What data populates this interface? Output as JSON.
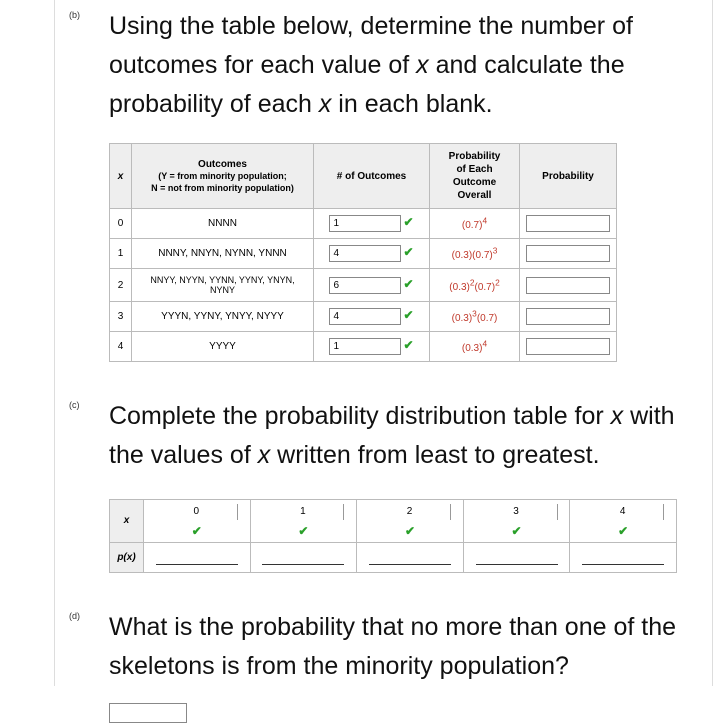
{
  "parts": {
    "b": {
      "label": "(b)",
      "prompt_pre": "Using the table below, determine the number of outcomes for each value of ",
      "prompt_var1": "x",
      "prompt_mid": " and calculate the probability of each ",
      "prompt_var2": "x",
      "prompt_post": " in each blank."
    },
    "c": {
      "label": "(c)",
      "prompt_pre": "Complete the probability distribution table for ",
      "prompt_var1": "x",
      "prompt_mid": " with the values of ",
      "prompt_var2": "x",
      "prompt_post": " written from least to greatest."
    },
    "d": {
      "label": "(d)",
      "prompt": "What is the probability that no more than one of the skeletons is from the minority population?"
    }
  },
  "table1": {
    "headers": {
      "x": "x",
      "outcomes_title": "Outcomes",
      "outcomes_sub1": "(Y = from minority population;",
      "outcomes_sub2": "N = not from minority population)",
      "num": "# of Outcomes",
      "prob_each_l1": "Probability",
      "prob_each_l2": "of Each Outcome",
      "prob_each_l3": "Overall",
      "prob": "Probability"
    },
    "rows": [
      {
        "x": "0",
        "outcomes": "NNNN",
        "num": "1",
        "prob_base": "(0.7)",
        "prob_exp": "4",
        "prob_pre": ""
      },
      {
        "x": "1",
        "outcomes": "NNNY, NNYN, NYNN, YNNN",
        "num": "4",
        "prob_pre": "(0.3)(0.7)",
        "prob_exp": "3",
        "prob_base": ""
      },
      {
        "x": "2",
        "outcomes": "NNYY, NYYN, YYNN, YYNY, YNYN, NYNY",
        "num": "6",
        "prob_pre": "(0.3)",
        "prob_mid_exp": "2",
        "prob_post": "(0.7)",
        "prob_exp": "2"
      },
      {
        "x": "3",
        "outcomes": "YYYN, YYNY, YNYY, NYYY",
        "num": "4",
        "prob_pre": "(0.3)",
        "prob_mid_exp": "3",
        "prob_post": "(0.7)",
        "prob_exp": ""
      },
      {
        "x": "4",
        "outcomes": "YYYY",
        "num": "1",
        "prob_base": "(0.3)",
        "prob_exp": "4",
        "prob_pre": ""
      }
    ]
  },
  "table2": {
    "row1_label": "x",
    "row2_label": "p(x)",
    "xvals": [
      "0",
      "1",
      "2",
      "3",
      "4"
    ]
  },
  "chart_data": {
    "type": "table",
    "title": "Binomial outcomes n=4, p=0.3 (Y=minority, N=not minority)",
    "columns": [
      "x",
      "Outcomes",
      "# of Outcomes",
      "Probability of Each Outcome",
      "Probability"
    ],
    "rows": [
      {
        "x": 0,
        "outcomes": "NNNN",
        "n_outcomes": 1,
        "each_outcome_prob": "(0.7)^4",
        "probability": null
      },
      {
        "x": 1,
        "outcomes": "NNNY, NNYN, NYNN, YNNN",
        "n_outcomes": 4,
        "each_outcome_prob": "(0.3)(0.7)^3",
        "probability": null
      },
      {
        "x": 2,
        "outcomes": "NNYY, NYYN, YYNN, YYNY, YNYN, NYNY",
        "n_outcomes": 6,
        "each_outcome_prob": "(0.3)^2(0.7)^2",
        "probability": null
      },
      {
        "x": 3,
        "outcomes": "YYYN, YYNY, YNYY, NYYY",
        "n_outcomes": 4,
        "each_outcome_prob": "(0.3)^3(0.7)",
        "probability": null
      },
      {
        "x": 4,
        "outcomes": "YYYY",
        "n_outcomes": 1,
        "each_outcome_prob": "(0.3)^4",
        "probability": null
      }
    ],
    "distribution_table": {
      "x": [
        0,
        1,
        2,
        3,
        4
      ],
      "p_x": [
        null,
        null,
        null,
        null,
        null
      ]
    }
  }
}
